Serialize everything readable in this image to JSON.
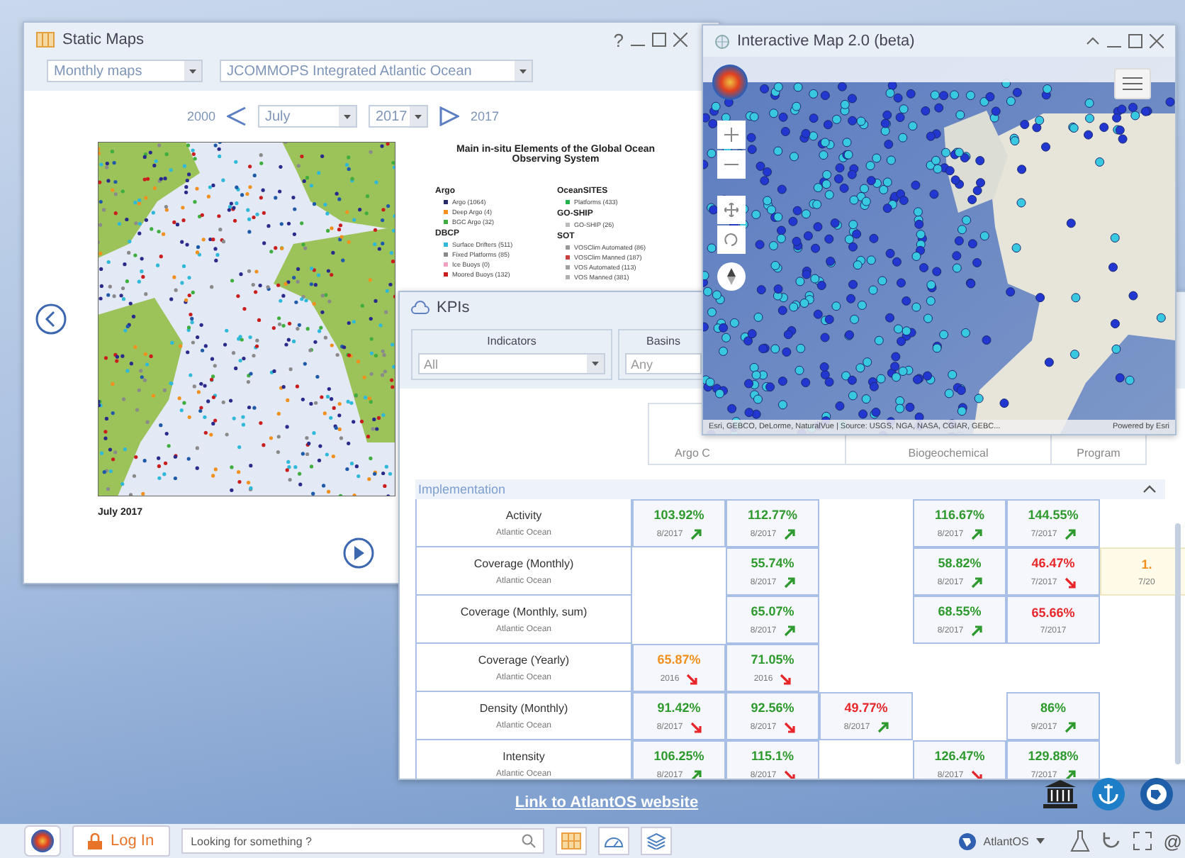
{
  "static_maps": {
    "title": "Static Maps",
    "help": "?",
    "map_type": "Monthly maps",
    "region": "JCOMMOPS Integrated Atlantic Ocean",
    "nav": {
      "start_year": "2000",
      "month": "July",
      "year": "2017",
      "end_year": "2017"
    },
    "legend": {
      "title": "Main in-situ Elements of the Global Ocean Observing System",
      "columns": [
        {
          "groups": [
            {
              "title": "Argo",
              "items": [
                {
                  "label": "Argo (1064)",
                  "color": "#2a2a6a"
                },
                {
                  "label": "Deep Argo (4)",
                  "color": "#f0901e"
                },
                {
                  "label": "BGC Argo (32)",
                  "color": "#3fae3f"
                }
              ]
            },
            {
              "title": "DBCP",
              "items": [
                {
                  "label": "Surface Drifters (511)",
                  "color": "#2fb8d8"
                },
                {
                  "label": "Fixed Platforms (85)",
                  "color": "#8a8a8a"
                },
                {
                  "label": "Ice Buoys (0)",
                  "color": "#f2a0c0"
                },
                {
                  "label": "Moored Buoys (132)",
                  "color": "#c81e1e"
                }
              ]
            }
          ]
        },
        {
          "groups": [
            {
              "title": "OceanSITES",
              "items": [
                {
                  "label": "Platforms (433)",
                  "color": "#22b14c"
                }
              ]
            },
            {
              "title": "GO-SHIP",
              "items": [
                {
                  "label": "GO-SHIP (26)",
                  "color": "#bbbbbb"
                }
              ]
            },
            {
              "title": "SOT",
              "items": [
                {
                  "label": "VOSClim Automated (86)",
                  "color": "#9a9a9a"
                },
                {
                  "label": "VOSClim Manned (187)",
                  "color": "#c84040"
                },
                {
                  "label": "VOS Automated (113)",
                  "color": "#a0a0a0"
                },
                {
                  "label": "VOS Manned (381)",
                  "color": "#b0b0b0"
                }
              ]
            }
          ]
        }
      ]
    },
    "caption": "July 2017"
  },
  "kpis": {
    "title": "KPIs",
    "filters": [
      {
        "label": "Indicators",
        "value": "All"
      },
      {
        "label": "Basins",
        "value": "Any"
      }
    ],
    "headers": [
      {
        "label": "Argo C"
      },
      {
        "label": "Biogeochemical"
      },
      {
        "label": "Program"
      }
    ],
    "section": {
      "title": "Implementation",
      "expanded": true
    },
    "rows": [
      {
        "name": "Activity",
        "basin": "Atlantic Ocean",
        "cells": [
          {
            "kind": "kpi",
            "value": "103.92%",
            "color": "#2e9a2e",
            "date": "8/2017",
            "arrow": true,
            "rising": true
          },
          {
            "kind": "kpi",
            "value": "112.77%",
            "color": "#2e9a2e",
            "date": "8/2017",
            "arrow": true,
            "rising": true
          },
          {
            "kind": "blank"
          },
          {
            "kind": "kpi",
            "value": "116.67%",
            "color": "#2e9a2e",
            "date": "8/2017",
            "arrow": true,
            "rising": true
          },
          {
            "kind": "kpi",
            "value": "144.55%",
            "color": "#2e9a2e",
            "date": "7/2017",
            "arrow": true,
            "rising": true
          }
        ]
      },
      {
        "name": "Coverage (Monthly)",
        "basin": "Atlantic Ocean",
        "cells": [
          {
            "kind": "blank"
          },
          {
            "kind": "kpi",
            "value": "55.74%",
            "color": "#2e9a2e",
            "date": "8/2017",
            "arrow": true,
            "rising": true
          },
          {
            "kind": "blank"
          },
          {
            "kind": "kpi",
            "value": "58.82%",
            "color": "#2e9a2e",
            "date": "8/2017",
            "arrow": true,
            "rising": true
          },
          {
            "kind": "kpi",
            "value": "46.47%",
            "color": "#e8262a",
            "date": "7/2017",
            "arrow": true,
            "rising": false
          },
          {
            "kind": "kpi",
            "value": "1.",
            "color": "#f0901e",
            "date": "7/20",
            "arrow": false,
            "highlighted": true
          }
        ]
      },
      {
        "name": "Coverage (Monthly, sum)",
        "basin": "Atlantic Ocean",
        "cells": [
          {
            "kind": "blank"
          },
          {
            "kind": "kpi",
            "value": "65.07%",
            "color": "#2e9a2e",
            "date": "8/2017",
            "arrow": true,
            "rising": true
          },
          {
            "kind": "blank"
          },
          {
            "kind": "kpi",
            "value": "68.55%",
            "color": "#2e9a2e",
            "date": "8/2017",
            "arrow": true,
            "rising": true
          },
          {
            "kind": "kpi",
            "value": "65.66%",
            "color": "#e8262a",
            "date": "7/2017",
            "arrow": false
          }
        ]
      },
      {
        "name": "Coverage (Yearly)",
        "basin": "Atlantic Ocean",
        "cells": [
          {
            "kind": "kpi",
            "value": "65.87%",
            "color": "#f0901e",
            "date": "2016",
            "arrow": true,
            "rising": false
          },
          {
            "kind": "kpi",
            "value": "71.05%",
            "color": "#2e9a2e",
            "date": "2016",
            "arrow": true,
            "rising": false
          }
        ]
      },
      {
        "name": "Density (Monthly)",
        "basin": "Atlantic Ocean",
        "cells": [
          {
            "kind": "kpi",
            "value": "91.42%",
            "color": "#2e9a2e",
            "date": "8/2017",
            "arrow": true,
            "rising": false
          },
          {
            "kind": "kpi",
            "value": "92.56%",
            "color": "#2e9a2e",
            "date": "8/2017",
            "arrow": true,
            "rising": false
          },
          {
            "kind": "kpi",
            "value": "49.77%",
            "color": "#e8262a",
            "date": "8/2017",
            "arrow": true,
            "rising": true
          },
          {
            "kind": "blank"
          },
          {
            "kind": "kpi",
            "value": "86%",
            "color": "#2e9a2e",
            "date": "9/2017",
            "arrow": true,
            "rising": true
          }
        ]
      },
      {
        "name": "Intensity",
        "basin": "Atlantic Ocean",
        "cells": [
          {
            "kind": "kpi",
            "value": "106.25%",
            "color": "#2e9a2e",
            "date": "8/2017",
            "arrow": true,
            "rising": true
          },
          {
            "kind": "kpi",
            "value": "115.1%",
            "color": "#2e9a2e",
            "date": "8/2017",
            "arrow": true,
            "rising": false
          },
          {
            "kind": "blank"
          },
          {
            "kind": "kpi",
            "value": "126.47%",
            "color": "#2e9a2e",
            "date": "8/2017",
            "arrow": true,
            "rising": false
          },
          {
            "kind": "kpi",
            "value": "129.88%",
            "color": "#2e9a2e",
            "date": "7/2017",
            "arrow": true,
            "rising": true
          }
        ]
      }
    ]
  },
  "interactive_map": {
    "title": "Interactive Map 2.0 (beta)",
    "attribution": "Esri, GEBCO, DeLorme, NaturalVue | Source: USGS, NGA, NASA, CGIAR, GEBC...",
    "powered_by": "Powered by Esri"
  },
  "desktop": {
    "link": "Link to AtlantOS website"
  },
  "taskbar": {
    "login": "Log In",
    "search": {
      "placeholder": "Looking for something ?"
    },
    "account": "AtlantOS",
    "at_sign": "@"
  }
}
